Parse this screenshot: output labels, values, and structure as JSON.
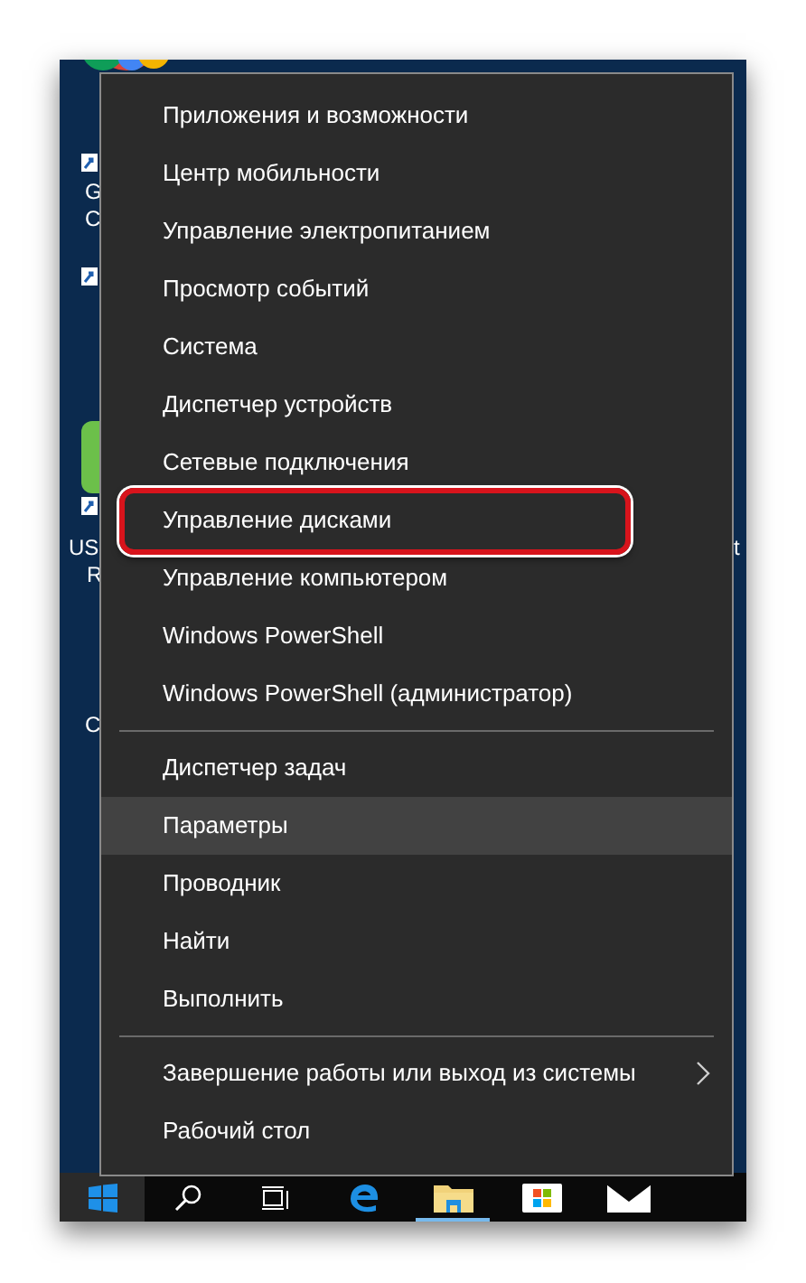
{
  "desktop": {
    "labels": [
      {
        "text": "G"
      },
      {
        "text": "C"
      },
      {
        "text": "US"
      },
      {
        "text": "R"
      },
      {
        "text": "C"
      },
      {
        "text": "t"
      }
    ]
  },
  "menu": {
    "groups": [
      [
        {
          "label": "Приложения и возможности",
          "hovered": false,
          "annotated": false,
          "submenu": false
        },
        {
          "label": "Центр мобильности",
          "hovered": false,
          "annotated": false,
          "submenu": false
        },
        {
          "label": "Управление электропитанием",
          "hovered": false,
          "annotated": false,
          "submenu": false
        },
        {
          "label": "Просмотр событий",
          "hovered": false,
          "annotated": false,
          "submenu": false
        },
        {
          "label": "Система",
          "hovered": false,
          "annotated": false,
          "submenu": false
        },
        {
          "label": "Диспетчер устройств",
          "hovered": false,
          "annotated": false,
          "submenu": false
        },
        {
          "label": "Сетевые подключения",
          "hovered": false,
          "annotated": false,
          "submenu": false
        },
        {
          "label": "Управление дисками",
          "hovered": false,
          "annotated": true,
          "submenu": false
        },
        {
          "label": "Управление компьютером",
          "hovered": false,
          "annotated": false,
          "submenu": false
        },
        {
          "label": "Windows PowerShell",
          "hovered": false,
          "annotated": false,
          "submenu": false
        },
        {
          "label": "Windows PowerShell (администратор)",
          "hovered": false,
          "annotated": false,
          "submenu": false
        }
      ],
      [
        {
          "label": "Диспетчер задач",
          "hovered": false,
          "annotated": false,
          "submenu": false
        },
        {
          "label": "Параметры",
          "hovered": true,
          "annotated": false,
          "submenu": false
        },
        {
          "label": "Проводник",
          "hovered": false,
          "annotated": false,
          "submenu": false
        },
        {
          "label": "Найти",
          "hovered": false,
          "annotated": false,
          "submenu": false
        },
        {
          "label": "Выполнить",
          "hovered": false,
          "annotated": false,
          "submenu": false
        }
      ],
      [
        {
          "label": "Завершение работы или выход из системы",
          "hovered": false,
          "annotated": false,
          "submenu": true
        },
        {
          "label": "Рабочий стол",
          "hovered": false,
          "annotated": false,
          "submenu": false
        }
      ]
    ]
  },
  "taskbar": {
    "start_highlighted": true,
    "apps": [
      {
        "kind": "search",
        "active": false
      },
      {
        "kind": "taskview",
        "active": false
      },
      {
        "kind": "browser",
        "active": false
      },
      {
        "kind": "explorer",
        "active": true
      },
      {
        "kind": "store",
        "active": false
      },
      {
        "kind": "mail",
        "active": false
      }
    ]
  }
}
